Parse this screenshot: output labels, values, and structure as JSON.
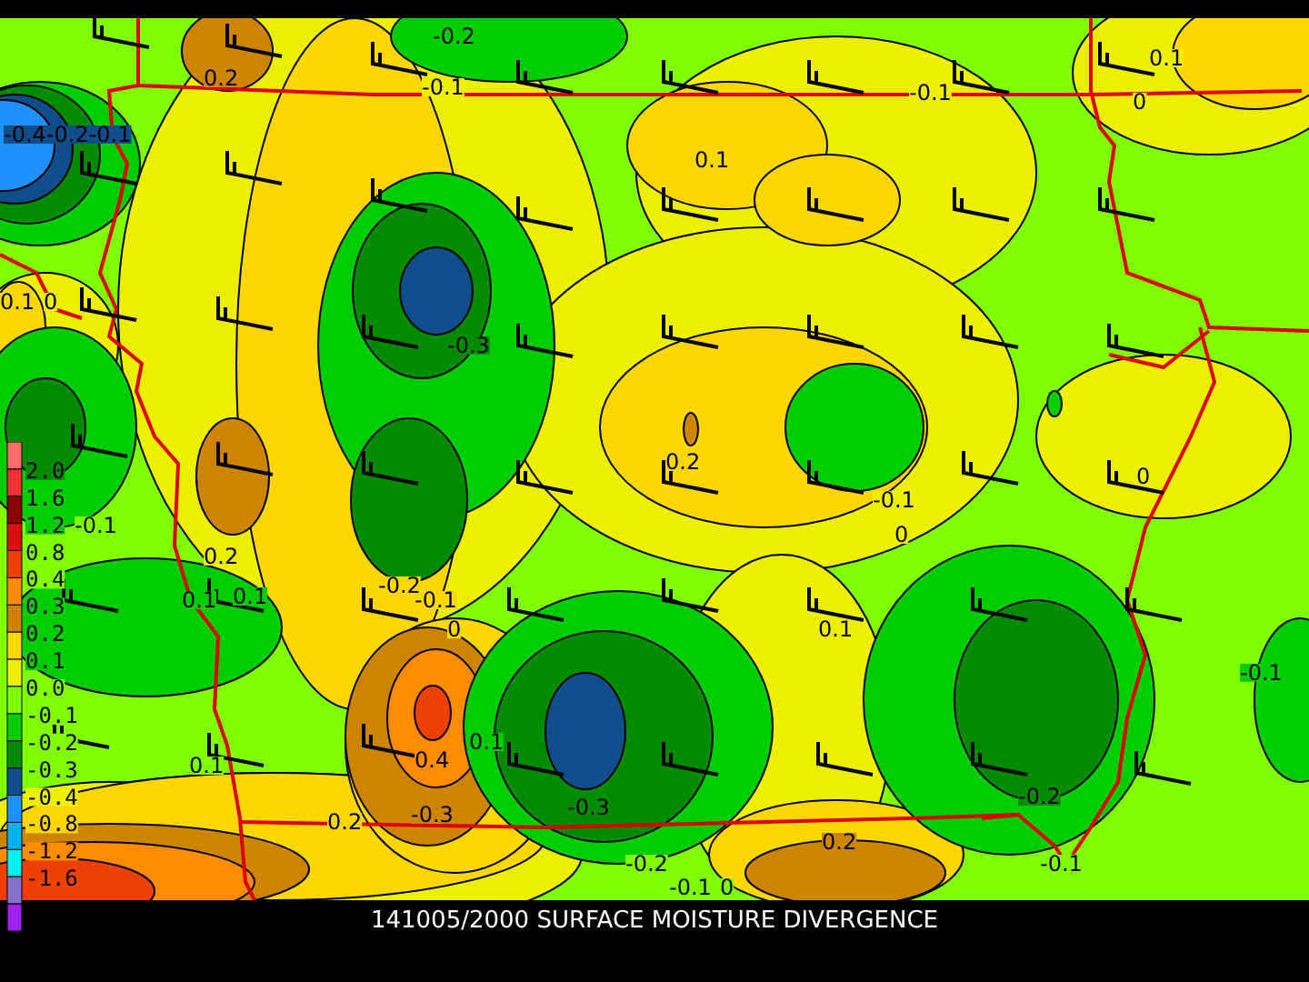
{
  "map": {
    "contour_labels": [
      "0.2",
      "-0.2",
      "-0.1",
      "-0.1",
      "0.1",
      "0",
      "0.1",
      "-0.4-0.2-0.1",
      "0.1",
      "0",
      "-0.3",
      "0.2",
      "-0.1",
      "0",
      "0",
      "-0.1",
      "0.2",
      "0.1",
      "0.1",
      "-0.2",
      "-0.1",
      "0",
      "0.1",
      "-0.1",
      "0.1",
      "0.4",
      "0.1",
      "-0.3",
      "0.2",
      "-0.3",
      "-0.2",
      "-0.2",
      "-0.1",
      "0",
      "0.2",
      "-0.1"
    ]
  },
  "legend": {
    "swatches": [
      {
        "color": "#ff6a6a"
      },
      {
        "color": "#ee3030"
      },
      {
        "color": "#8b0000"
      },
      {
        "color": "#dd1010"
      },
      {
        "color": "#ee4000"
      },
      {
        "color": "#ff8c00"
      },
      {
        "color": "#cd8500"
      },
      {
        "color": "#ffd700"
      },
      {
        "color": "#eeee00"
      },
      {
        "color": "#7fff00"
      },
      {
        "color": "#00cd00"
      },
      {
        "color": "#008b00"
      },
      {
        "color": "#104e8b"
      },
      {
        "color": "#1e90ff"
      },
      {
        "color": "#00b2ee"
      },
      {
        "color": "#00eeee"
      },
      {
        "color": "#8470c8"
      },
      {
        "color": "#a020f0"
      }
    ],
    "labels": [
      "2.0",
      "1.6",
      "1.2",
      "0.8",
      "0.4",
      "0.3",
      "0.2",
      "0.1",
      "0.0",
      "-0.1",
      "-0.2",
      "-0.3",
      "-0.4",
      "-0.8",
      "-1.2",
      "-1.6"
    ]
  },
  "title": "141005/2000 SURFACE MOISTURE DIVERGENCE"
}
